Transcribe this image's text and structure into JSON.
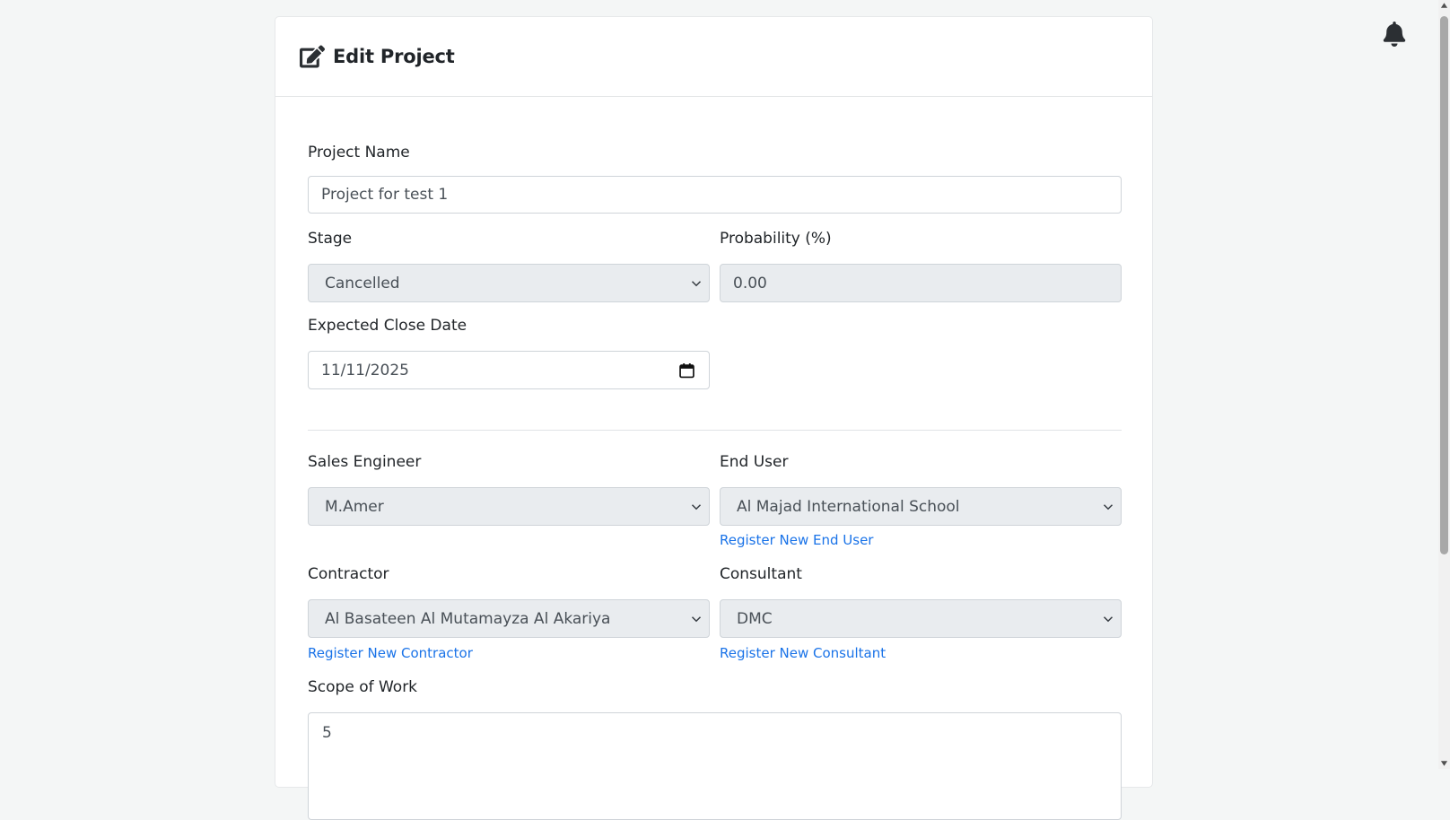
{
  "header": {
    "title": "Edit Project",
    "icon": "edit-icon"
  },
  "form": {
    "project_name": {
      "label": "Project Name",
      "value": "Project for test 1"
    },
    "stage": {
      "label": "Stage",
      "value": "Cancelled"
    },
    "probability": {
      "label": "Probability (%)",
      "value": "0.00"
    },
    "expected_close_date": {
      "label": "Expected Close Date",
      "value": "11/11/2025"
    },
    "sales_engineer": {
      "label": "Sales Engineer",
      "value": "M.Amer"
    },
    "end_user": {
      "label": "End User",
      "value": "Al Majad International School",
      "register_link": "Register New End User"
    },
    "contractor": {
      "label": "Contractor",
      "value": "Al Basateen Al Mutamayza Al Akariya",
      "register_link": "Register New Contractor"
    },
    "consultant": {
      "label": "Consultant",
      "value": "DMC",
      "register_link": "Register New Consultant"
    },
    "scope_of_work": {
      "label": "Scope of Work",
      "value": "5"
    }
  },
  "notifications": {
    "icon": "bell-icon"
  },
  "colors": {
    "link": "#1a73e8",
    "disabled_bg": "#e9ecef",
    "page_bg": "#f4f6f6"
  }
}
